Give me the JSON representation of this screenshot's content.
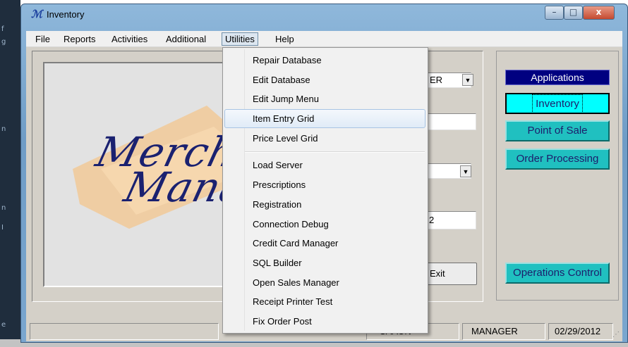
{
  "window": {
    "title": "Inventory",
    "controls": {
      "minimize": "–",
      "maximize": "□",
      "close": "x"
    }
  },
  "menubar": {
    "items": [
      "File",
      "Reports",
      "Activities",
      "Additional",
      "Utilities",
      "Help"
    ],
    "active": "Utilities"
  },
  "utilities_menu": {
    "items": [
      "Repair Database",
      "Edit Database",
      "Edit Jump Menu",
      "Item Entry Grid",
      "Price Level Grid",
      "Load Server",
      "Prescriptions",
      "Registration",
      "Connection Debug",
      "Credit Card Manager",
      "SQL Builder",
      "Open Sales Manager",
      "Receipt Printer Test",
      "Fix Order Post"
    ],
    "highlighted": "Item Entry Grid"
  },
  "logo": {
    "line1": "Merchan",
    "line2": "Manag"
  },
  "form": {
    "user_value_visible": "ER",
    "field_value_visible": "2",
    "exit_label": "Exit"
  },
  "applications": {
    "header": "Applications",
    "buttons": [
      "Inventory",
      "Point of Sale",
      "Order Processing",
      "Operations Control"
    ],
    "selected": "Inventory"
  },
  "statusbar": {
    "left_partial": "SAAUN",
    "user": "MANAGER",
    "date": "02/29/2012"
  },
  "colors": {
    "applications_header_bg": "#000080",
    "app_button_bg": "#20c0c0",
    "app_button_selected_bg": "#00ffff",
    "logo_text": "#1a2170",
    "logo_swoosh": "#f3c58e"
  }
}
